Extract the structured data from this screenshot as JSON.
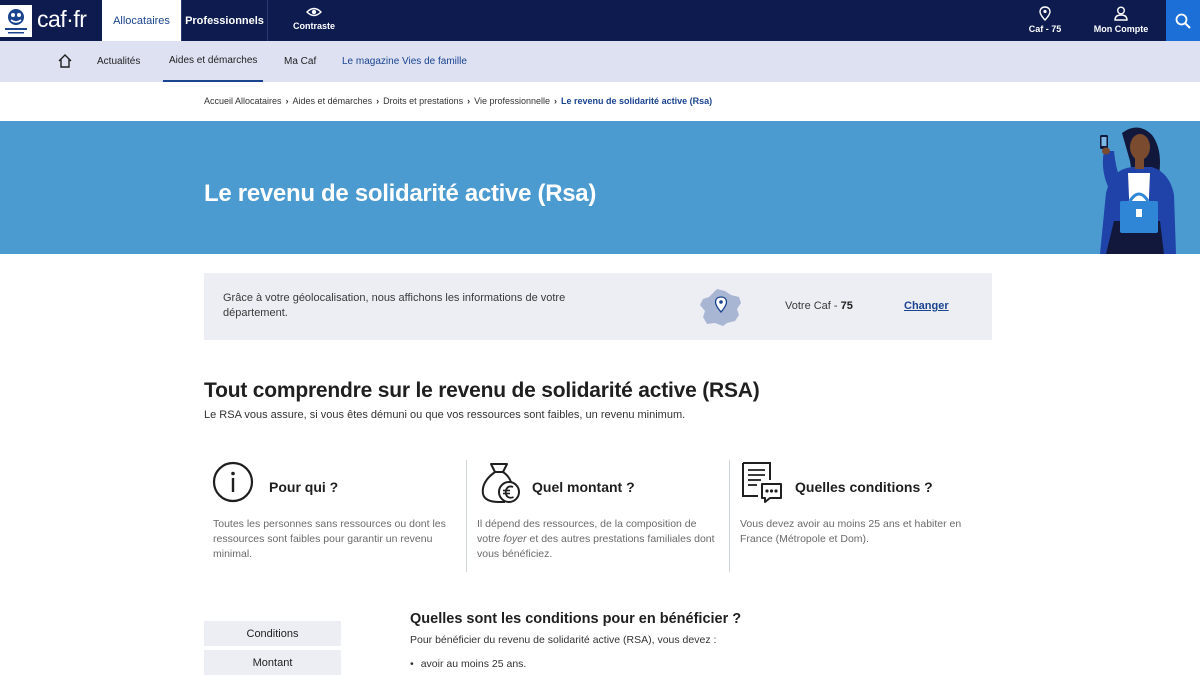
{
  "header": {
    "logo_text": "caf·fr",
    "tabs": [
      {
        "label": "Allocataires",
        "active": true
      },
      {
        "label": "Professionnels",
        "active": false
      }
    ],
    "contrast_label": "Contraste",
    "caf_label": "Caf - 75",
    "account_label": "Mon Compte"
  },
  "nav": {
    "items": [
      {
        "label": "Actualités"
      },
      {
        "label": "Aides et démarches",
        "active": true
      },
      {
        "label": "Ma Caf"
      },
      {
        "label": "Le magazine Vies de famille"
      }
    ]
  },
  "breadcrumb": {
    "items": [
      "Accueil Allocataires",
      "Aides et démarches",
      "Droits et prestations",
      "Vie professionnelle"
    ],
    "current": "Le revenu de solidarité active (Rsa)"
  },
  "hero": {
    "title": "Le revenu de solidarité active (Rsa)"
  },
  "geoloc": {
    "text": "Grâce à votre géolocalisation, nous affichons les informations de votre département.",
    "caf_prefix": "Votre Caf - ",
    "caf_number": "75",
    "change_label": "Changer"
  },
  "section": {
    "title": "Tout comprendre sur le revenu de solidarité active (RSA)",
    "subtitle": "Le RSA vous assure, si vous êtes démuni ou que vos ressources sont faibles, un revenu minimum."
  },
  "cards": [
    {
      "icon": "info-icon",
      "title": "Pour qui ?",
      "desc": "Toutes les personnes sans ressources ou dont les ressources sont faibles pour garantir un revenu minimal."
    },
    {
      "icon": "money-bag-icon",
      "title": "Quel montant ?",
      "desc_before": "Il dépend des ressources, de la composition de votre ",
      "desc_em": "foyer",
      "desc_after": " et des autres prestations familiales dont vous bénéficiez."
    },
    {
      "icon": "document-chat-icon",
      "title": "Quelles conditions ?",
      "desc": "Vous devez avoir au moins 25 ans et habiter en France (Métropole et Dom)."
    }
  ],
  "side_nav": {
    "items": [
      "Conditions",
      "Montant"
    ]
  },
  "conditions": {
    "title": "Quelles sont les conditions pour en bénéficier ?",
    "intro": "Pour bénéficier du revenu de solidarité active (RSA), vous devez :",
    "bullets": [
      "avoir au moins 25 ans."
    ]
  },
  "colors": {
    "navy": "#0d1b4f",
    "hero_blue": "#4b9bd0",
    "link_blue": "#1a4390",
    "subnav_bg": "#dde1f2"
  }
}
